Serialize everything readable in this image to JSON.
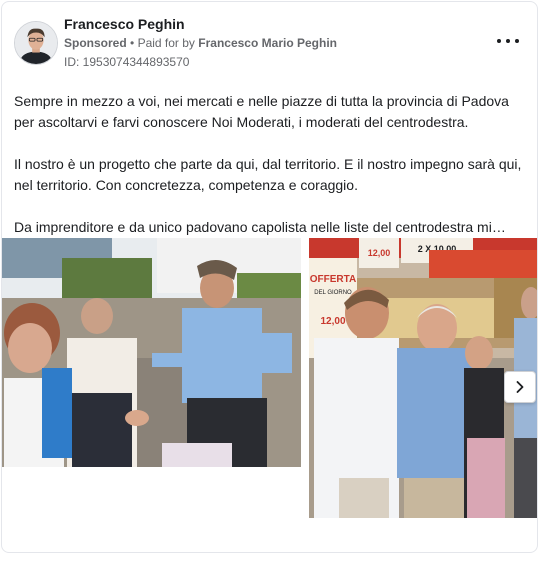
{
  "ad": {
    "page_name": "Francesco Peghin",
    "sponsored_label": "Sponsored",
    "paid_prefix": "Paid for by",
    "payer_name": "Francesco Mario Peghin",
    "id_text": "ID: 1953074344893570",
    "more_icon": "more-horizontal-icon"
  },
  "body": {
    "paragraphs": [
      "Sempre in mezzo a voi, nei mercati e nelle piazze di tutta la provincia di Padova per ascoltarvi e farvi conoscere Noi Moderati, i moderati del centrodestra.",
      "Il nostro è un progetto che parte da qui, dal territorio. E il nostro impegno sarà qui, nel territorio. Con concretezza, competenza e coraggio.",
      "Da imprenditore e da unico padovano capolista nelle liste del centrodestra mi…"
    ]
  },
  "carousel": {
    "photo_signs": {
      "offerta": "OFFERTA",
      "del_giorno": "DEL GIORNO",
      "price_1": "12,00",
      "price_2": "2 X 10,00",
      "price_3": "12,00"
    },
    "next_icon": "chevron-right-icon"
  },
  "colors": {
    "text_primary": "#1c1e21",
    "text_secondary": "#65676b",
    "border": "#e4e6eb"
  }
}
